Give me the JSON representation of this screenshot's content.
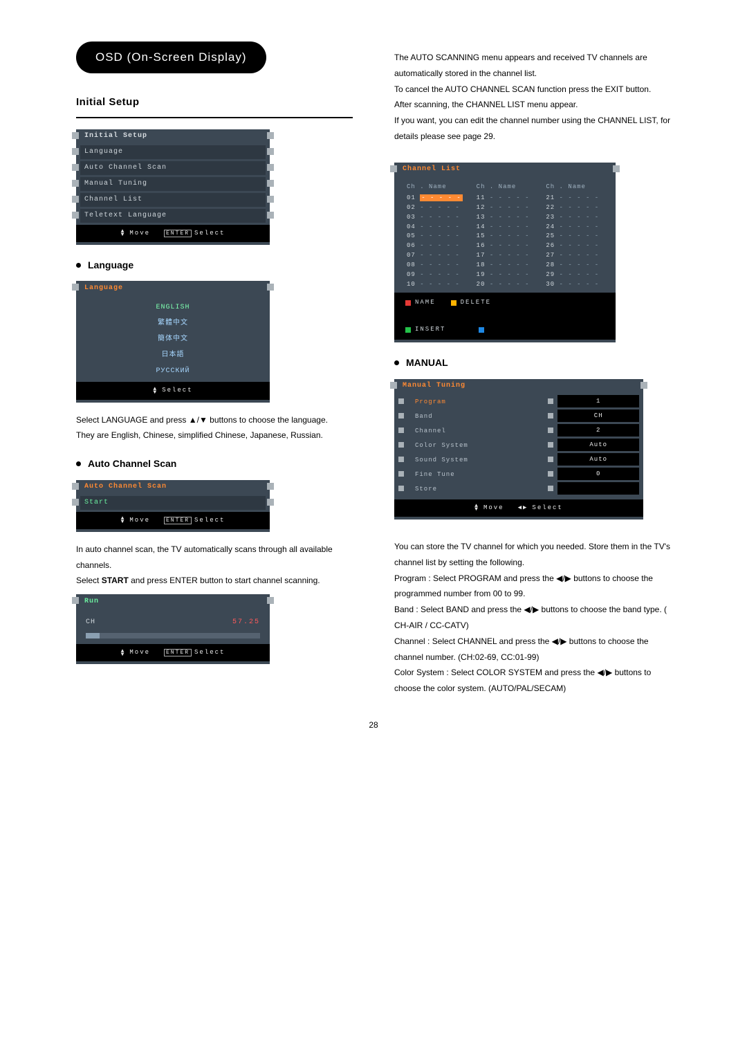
{
  "page": {
    "number": "28",
    "pill": "OSD (On-Screen Display)",
    "initial_setup": "Initial Setup"
  },
  "osd_initial": {
    "title": "Initial Setup",
    "items": [
      "Language",
      "Auto Channel Scan",
      "Manual Tuning",
      "Channel List",
      "Teletext Language"
    ],
    "foot_move": "Move",
    "foot_select": "Select",
    "foot_enter": "ENTER"
  },
  "language": {
    "heading": "Language",
    "panel_title": "Language",
    "items": [
      "ENGLISH",
      "繁體中文",
      "簡体中文",
      "日本語",
      "РУССКИЙ"
    ],
    "foot": "Select",
    "body1": "Select LANGUAGE and press ▲/▼ buttons to choose the language.",
    "body2": "They are English, Chinese, simplified Chinese, Japanese, Russian."
  },
  "autoscan": {
    "heading": "Auto Channel Scan",
    "panel_title": "Auto Channel Scan",
    "start": "Start",
    "foot_move": "Move",
    "foot_enter": "ENTER",
    "foot_select": "Select",
    "body1": "In auto channel scan, the TV automatically scans through all available channels.",
    "body2": "Select START and press ENTER button to start channel scanning."
  },
  "run": {
    "panel_title": "Run",
    "ch": "CH",
    "freq": "57.25",
    "foot_move": "Move",
    "foot_enter": "ENTER",
    "foot_select": "Select"
  },
  "right_intro": {
    "p1": "The AUTO SCANNING menu appears and received TV channels are automatically stored in the channel list.",
    "p2": "To cancel the AUTO CHANNEL SCAN function press the EXIT button.",
    "p3": "After scanning, the CHANNEL LIST menu appear.",
    "p4": "If you want, you can edit the channel number using the CHANNEL LIST, for details please see page 29."
  },
  "channel_list": {
    "title": "Channel List",
    "hdr": "Ch . Name",
    "col1": [
      "01",
      "02",
      "03",
      "04",
      "05",
      "06",
      "07",
      "08",
      "09",
      "10"
    ],
    "col2": [
      "11",
      "12",
      "13",
      "14",
      "15",
      "16",
      "17",
      "18",
      "19",
      "20"
    ],
    "col3": [
      "21",
      "22",
      "23",
      "24",
      "25",
      "26",
      "27",
      "28",
      "29",
      "30"
    ],
    "dots": "- - - - -",
    "legend": {
      "name": "NAME",
      "delete": "DELETE",
      "insert": "INSERT"
    }
  },
  "manual": {
    "heading": "MANUAL",
    "panel_title": "Manual Tuning",
    "rows": [
      {
        "label": "Program",
        "value": "1"
      },
      {
        "label": "Band",
        "value": "CH"
      },
      {
        "label": "Channel",
        "value": "2"
      },
      {
        "label": "Color System",
        "value": "Auto"
      },
      {
        "label": "Sound System",
        "value": "Auto"
      },
      {
        "label": "Fine Tune",
        "value": "0"
      },
      {
        "label": "Store",
        "value": ""
      }
    ],
    "foot_move": "Move",
    "foot_select": "Select",
    "body1": "You can store the TV channel for which you needed. Store them in the TV's channel list by setting the following.",
    "body2": "Program : Select PROGRAM and press the ◀/▶ buttons to choose the programmed number from 00 to 99.",
    "body3": "Band : Select BAND and press the ◀/▶ buttons to choose the band type. ( CH-AIR / CC-CATV)",
    "body4": "Channel : Select CHANNEL and press the ◀/▶ buttons to choose the channel number. (CH:02-69, CC:01-99)",
    "body5": "Color System : Select COLOR SYSTEM and press the ◀/▶ buttons to choose the color system. (AUTO/PAL/SECAM)"
  }
}
